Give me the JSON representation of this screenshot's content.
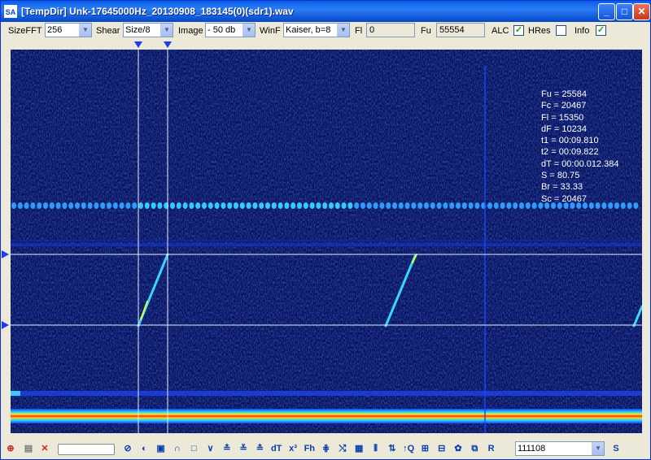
{
  "window": {
    "title": "[TempDir] Unk-17645000Hz_20130908_183145(0)(sdr1).wav",
    "app_icon_text": "SA",
    "min_label": "_",
    "max_label": "□",
    "close_label": "✕"
  },
  "toolbar": {
    "sizefft_label": "SizeFFT",
    "sizefft_value": "256",
    "shear_label": "Shear",
    "shear_value": "Size/8",
    "image_label": "Image",
    "image_value": "- 50 db",
    "winf_label": "WinF",
    "winf_value": "Kaiser, b=8",
    "fl_label": "Fl",
    "fl_value": "0",
    "fu_label": "Fu",
    "fu_value": "55554",
    "alc_label": "ALC",
    "alc_checked": true,
    "hres_label": "HRes",
    "hres_checked": false,
    "info_label": "Info",
    "info_checked": true,
    "check_mark": "✓",
    "arrow": "▼"
  },
  "info_lines": [
    "Fu = 25584",
    "Fc = 20467",
    "Fl = 15350",
    "dF = 10234",
    "t1 = 00:09.810",
    "t2 = 00:09.822",
    "dT = 00:00.012.384",
    "S = 80.75",
    "Br = 33.33",
    "Sc = 20467"
  ],
  "bottom": {
    "selector_value": "111108",
    "icon_glyphs": [
      "⊘",
      "◐",
      "▣",
      "∩",
      "□",
      "∨",
      "≛",
      "≚",
      "≛",
      "dT",
      "x³",
      "Fh",
      "⋕",
      "⤭",
      "▦",
      "⫴",
      "⇅",
      "↑Q",
      "⊞",
      "⊟",
      "✿",
      "⧉",
      "R"
    ],
    "end_icon": "S"
  },
  "colors": {
    "spectro_bg": "#06105a",
    "cursor": "#e8ecff",
    "marker": "#1c3ee8"
  }
}
